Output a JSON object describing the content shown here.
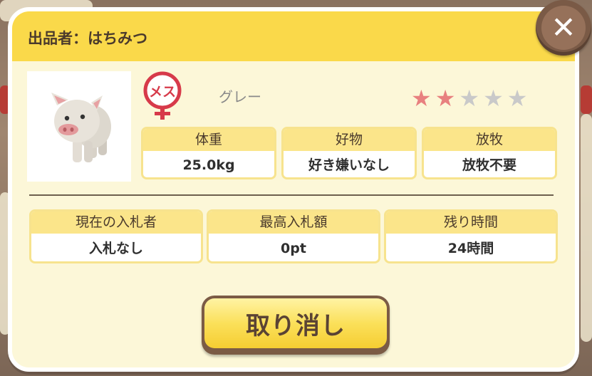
{
  "header": {
    "title": "出品者：はちみつ",
    "close_icon": "close-x-icon"
  },
  "pig": {
    "image": "pig-character-image",
    "gender_icon": "female-symbol-icon",
    "gender_text": "メス",
    "color": "グレー",
    "rating": 2,
    "rating_max": 5,
    "star_on_color": "#e8807f",
    "star_off_color": "#c9c9c9"
  },
  "stats": [
    {
      "label": "体重",
      "value": "25.0kg"
    },
    {
      "label": "好物",
      "value": "好き嫌いなし"
    },
    {
      "label": "放牧",
      "value": "放牧不要"
    }
  ],
  "auction": [
    {
      "label": "現在の入札者",
      "value": "入札なし"
    },
    {
      "label": "最高入札額",
      "value": "0pt"
    },
    {
      "label": "残り時間",
      "value": "24時間"
    }
  ],
  "cancel_button": {
    "label": "取り消し"
  },
  "colors": {
    "header": "#fad94a",
    "panel": "#fcf7d8",
    "accent_red": "#d73a4a"
  }
}
